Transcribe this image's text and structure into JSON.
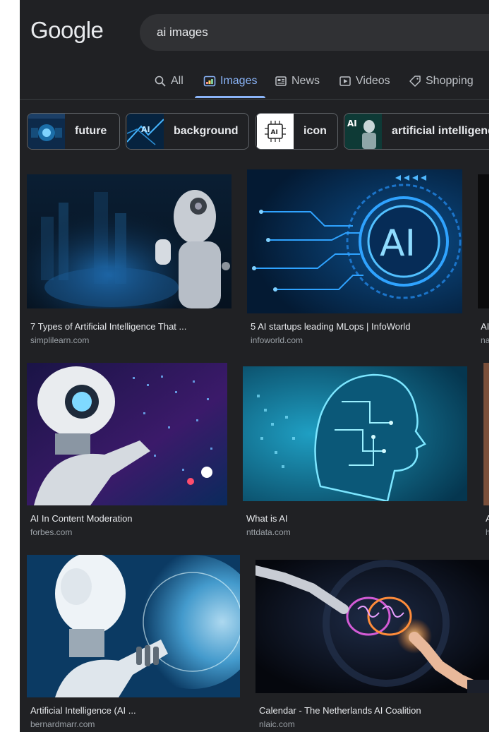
{
  "logo": "Google",
  "search": {
    "query": "ai images"
  },
  "tabs": [
    {
      "label": "All"
    },
    {
      "label": "Images"
    },
    {
      "label": "News"
    },
    {
      "label": "Videos"
    },
    {
      "label": "Shopping"
    }
  ],
  "chips": [
    {
      "label": "future"
    },
    {
      "label": "background"
    },
    {
      "label": "icon"
    },
    {
      "label": "artificial intelligence"
    }
  ],
  "results": [
    {
      "title": "7 Types of Artificial Intelligence That ...",
      "source": "simplilearn.com"
    },
    {
      "title": "5 AI startups leading MLops | InfoWorld",
      "source": "infoworld.com"
    },
    {
      "title": "AI",
      "source": "na"
    },
    {
      "title": "AI In Content Moderation",
      "source": "forbes.com"
    },
    {
      "title": "What is AI",
      "source": "nttdata.com"
    },
    {
      "title": "A",
      "source": "h"
    },
    {
      "title": "Artificial Intelligence (AI ...",
      "source": "bernardmarr.com"
    },
    {
      "title": "Calendar - The Netherlands AI Coalition",
      "source": "nlaic.com"
    }
  ],
  "colors": {
    "background": "#202124",
    "accent": "#8ab4f8",
    "text": "#e8eaed",
    "muted": "#9aa0a6"
  }
}
